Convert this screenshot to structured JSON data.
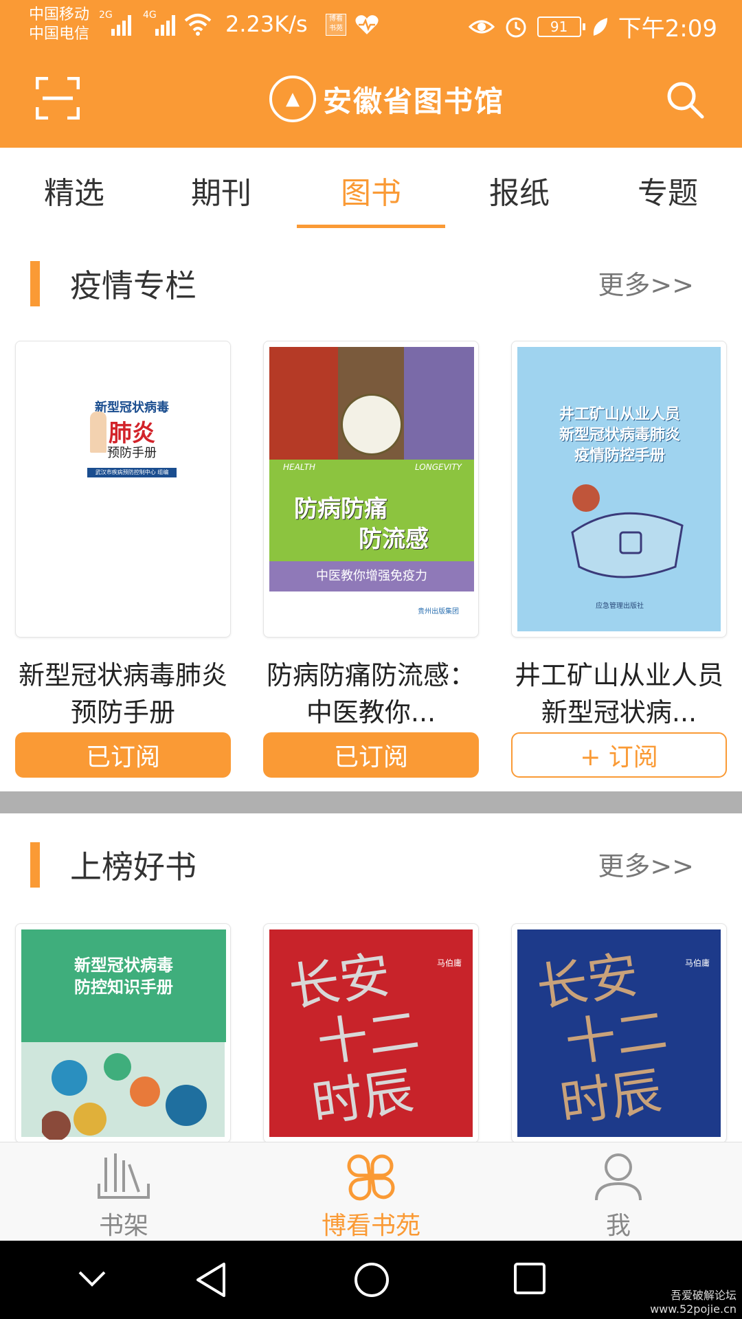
{
  "status_bar": {
    "carrier1": "中国移动",
    "carrier2": "中国电信",
    "net1": "2G",
    "net2": "4G",
    "net_speed": "2.23K/s",
    "badge_text": "博看书苑",
    "battery": "91",
    "time": "下午2:09"
  },
  "header": {
    "logo_text": "安徽省图书馆"
  },
  "tabs": [
    {
      "label": "精选"
    },
    {
      "label": "期刊"
    },
    {
      "label": "图书"
    },
    {
      "label": "报纸"
    },
    {
      "label": "专题"
    }
  ],
  "active_tab": "图书",
  "sections": [
    {
      "title": "疫情专栏",
      "more": "更多>>",
      "books": [
        {
          "title": "新型冠状病毒肺炎预防手册",
          "button": "已订阅",
          "subscribed": true,
          "cover": {
            "line1": "新型冠状病毒",
            "line2": "肺炎",
            "line3": "预防手册",
            "publisher": "武汉市疾病预防控制中心 组编"
          }
        },
        {
          "title": "防病防痛防流感：中医教你...",
          "button": "已订阅",
          "subscribed": true,
          "cover": {
            "line1": "防病防痛",
            "line2": "防流感",
            "band": "中医教你增强免疫力",
            "health": "HEALTH",
            "longevity": "LONGEVITY",
            "publisher": "贵州出版集团"
          }
        },
        {
          "title": "井工矿山从业人员新型冠状病...",
          "button": "+ 订阅",
          "subscribed": false,
          "cover": {
            "line1": "井工矿山从业人员",
            "line2": "新型冠状病毒肺炎",
            "line3": "疫情防控手册",
            "publisher": "应急管理出版社"
          }
        }
      ]
    },
    {
      "title": "上榜好书",
      "more": "更多>>",
      "books": [
        {
          "cover": {
            "line1": "新型冠状病毒",
            "line2": "防控知识手册"
          }
        },
        {
          "cover": {
            "line1": "长安",
            "line2": "十二",
            "line3": "时辰",
            "author": "马伯庸"
          }
        },
        {
          "cover": {
            "line1": "长安",
            "line2": "十二",
            "line3": "时辰",
            "author": "马伯庸"
          }
        }
      ]
    }
  ],
  "bottom_nav": [
    {
      "label": "书架",
      "icon": "bookshelf-icon"
    },
    {
      "label": "博看书苑",
      "icon": "clover-icon"
    },
    {
      "label": "我",
      "icon": "person-icon"
    }
  ],
  "colors": {
    "accent": "#fa9a35",
    "text": "#333333",
    "muted": "#777777"
  },
  "watermark": {
    "line1": "吾爱破解论坛",
    "line2": "www.52pojie.cn"
  }
}
